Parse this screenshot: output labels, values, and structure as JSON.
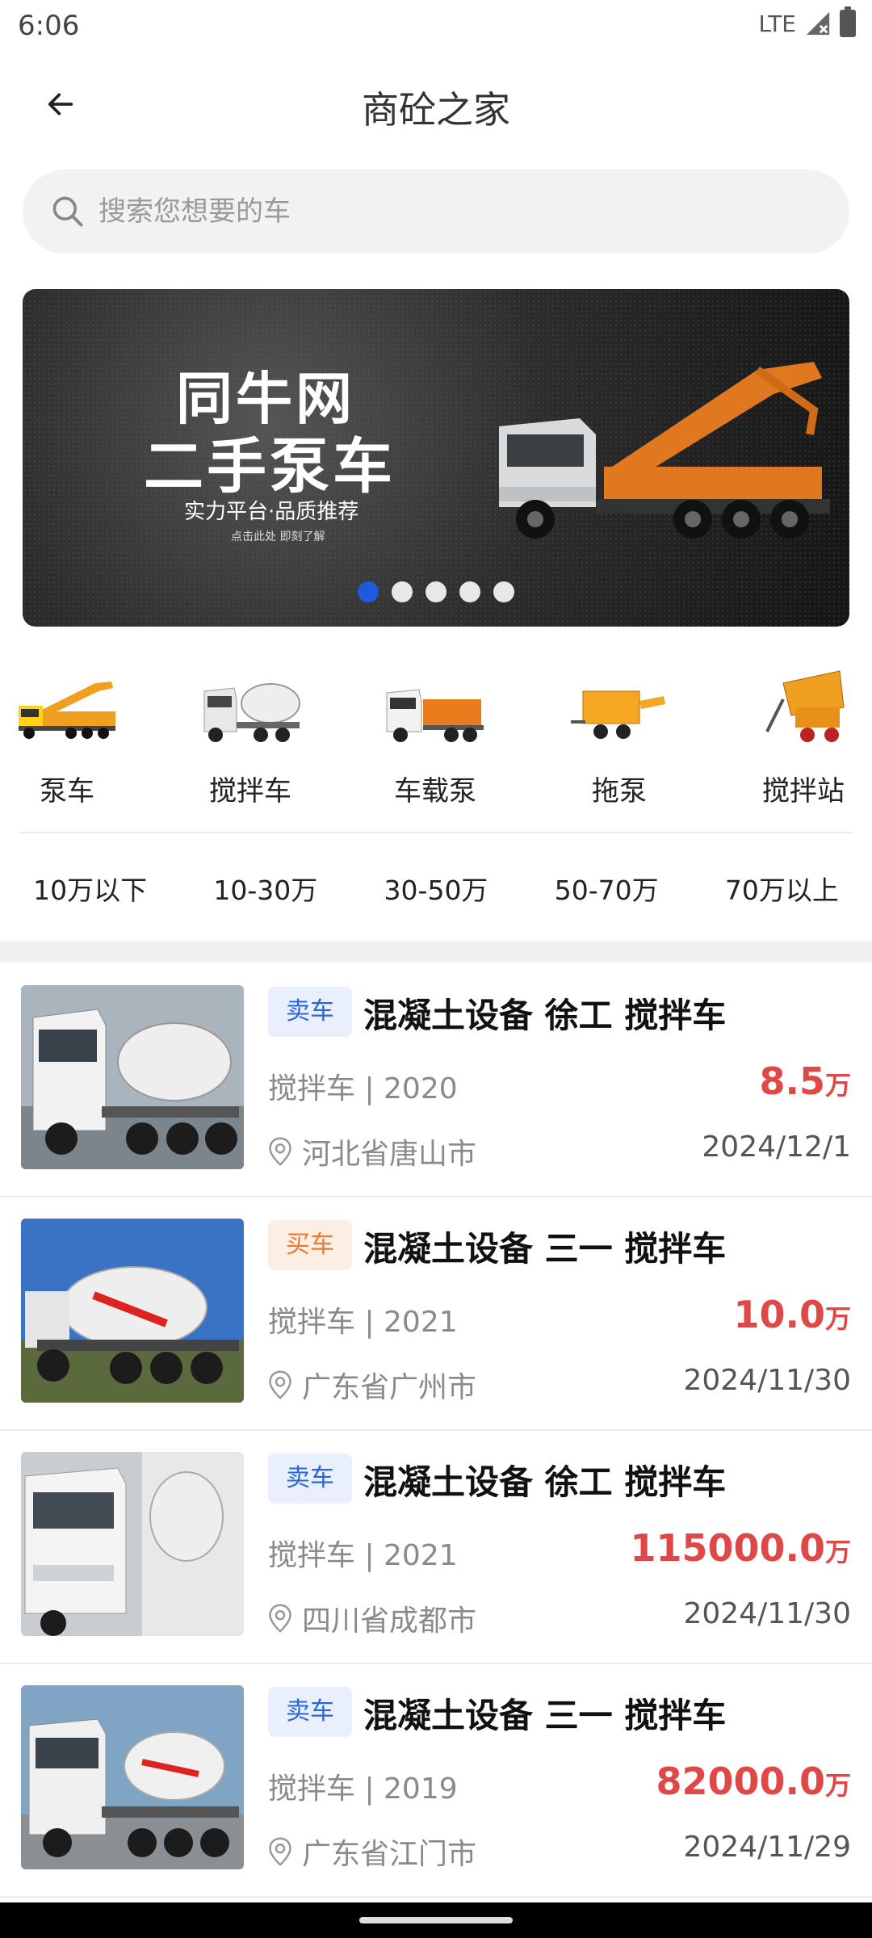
{
  "status": {
    "time": "6:06",
    "network": "LTE"
  },
  "header": {
    "title": "商砼之家"
  },
  "search": {
    "placeholder": "搜索您想要的车"
  },
  "banner": {
    "headline1": "同牛网",
    "headline2": "二手泵车",
    "subline": "实力平台·品质推荐",
    "small_text": "点击此处 即刻了解",
    "dots_count": 5,
    "active_dot": 1
  },
  "categories": [
    {
      "label": "泵车",
      "icon": "pump-truck-icon"
    },
    {
      "label": "搅拌车",
      "icon": "mixer-truck-icon"
    },
    {
      "label": "车载泵",
      "icon": "truck-mounted-pump-icon"
    },
    {
      "label": "拖泵",
      "icon": "trailer-pump-icon"
    },
    {
      "label": "搅拌站",
      "icon": "mixing-plant-icon"
    }
  ],
  "price_filters": [
    "10万以下",
    "10-30万",
    "30-50万",
    "50-70万",
    "70万以上"
  ],
  "listings": [
    {
      "badge": "卖车",
      "badge_type": "sell",
      "title": "混凝土设备 徐工 搅拌车",
      "spec": "搅拌车 | 2020",
      "price": "8.5",
      "unit": "万",
      "location": "河北省唐山市",
      "date": "2024/12/1"
    },
    {
      "badge": "买车",
      "badge_type": "buy",
      "title": "混凝土设备 三一 搅拌车",
      "spec": "搅拌车 | 2021",
      "price": "10.0",
      "unit": "万",
      "location": "广东省广州市",
      "date": "2024/11/30"
    },
    {
      "badge": "卖车",
      "badge_type": "sell",
      "title": "混凝土设备 徐工 搅拌车",
      "spec": "搅拌车 | 2021",
      "price": "115000.0",
      "unit": "万",
      "location": "四川省成都市",
      "date": "2024/11/30"
    },
    {
      "badge": "卖车",
      "badge_type": "sell",
      "title": "混凝土设备 三一 搅拌车",
      "spec": "搅拌车 | 2019",
      "price": "82000.0",
      "unit": "万",
      "location": "广东省江门市",
      "date": "2024/11/29"
    }
  ],
  "colors": {
    "accent": "#1d5bdc",
    "price": "#e04848",
    "sell_badge": "#2a67d6",
    "buy_badge": "#ec7a33"
  }
}
